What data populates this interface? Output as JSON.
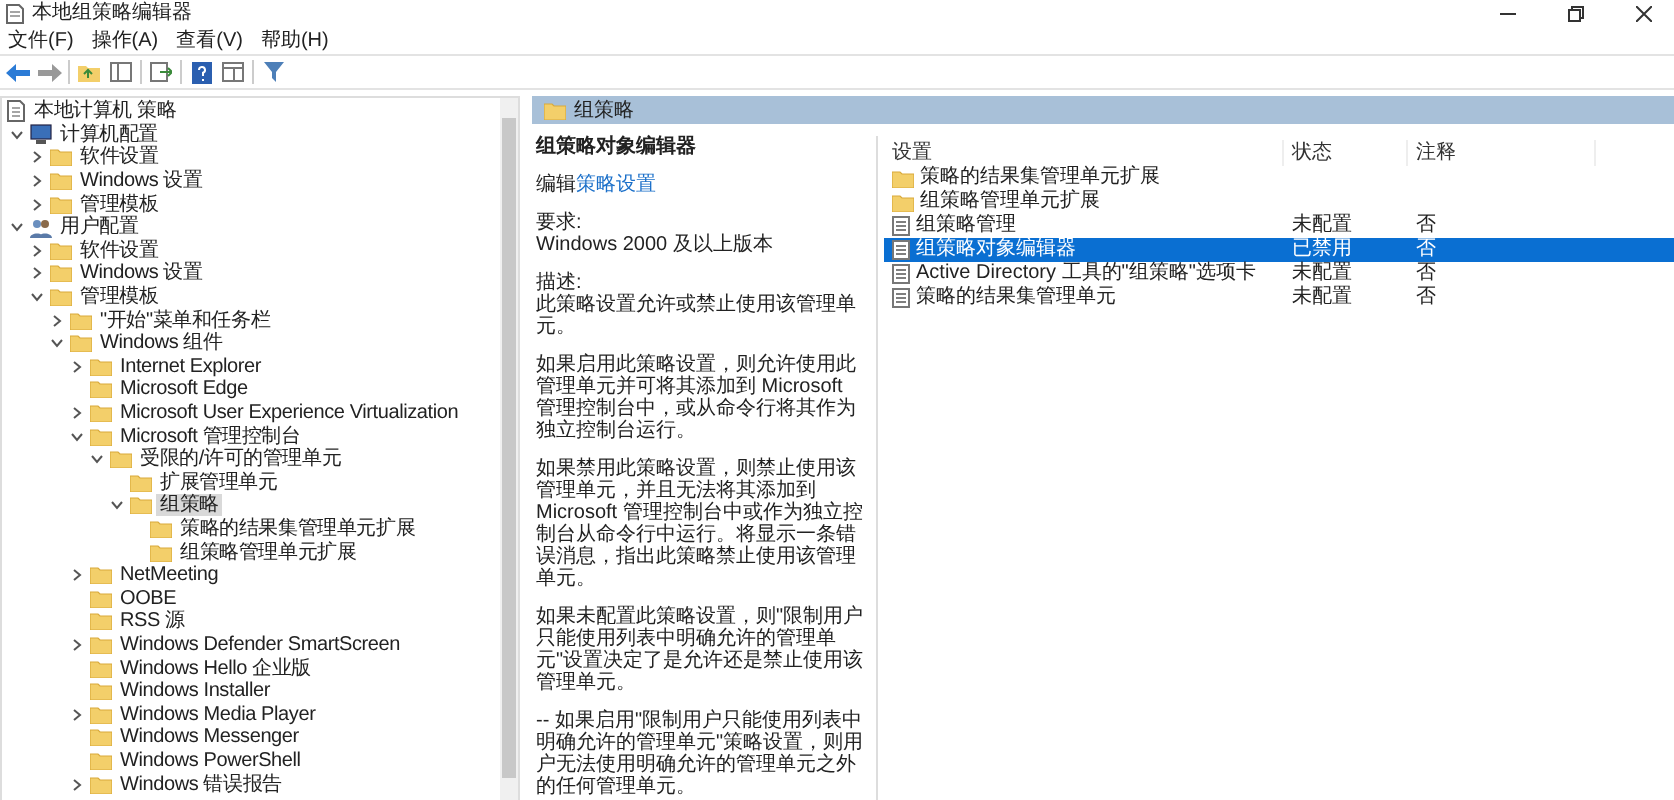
{
  "window": {
    "title": "本地组策略编辑器"
  },
  "menu": [
    "文件(F)",
    "操作(A)",
    "查看(V)",
    "帮助(H)"
  ],
  "tree": [
    {
      "label": "本地计算机 策略",
      "kind": "policy-root",
      "selected": false,
      "children": [
        {
          "label": "计算机配置",
          "kind": "computer",
          "expanded": true,
          "selected": false,
          "children": [
            {
              "label": "软件设置",
              "kind": "folder",
              "expanded": false,
              "selected": false
            },
            {
              "label": "Windows 设置",
              "kind": "folder",
              "expanded": false,
              "selected": false
            },
            {
              "label": "管理模板",
              "kind": "folder",
              "expanded": false,
              "selected": false
            }
          ]
        },
        {
          "label": "用户配置",
          "kind": "users",
          "expanded": true,
          "selected": false,
          "children": [
            {
              "label": "软件设置",
              "kind": "folder",
              "expanded": false,
              "selected": false
            },
            {
              "label": "Windows 设置",
              "kind": "folder",
              "expanded": false,
              "selected": false
            },
            {
              "label": "管理模板",
              "kind": "folder",
              "expanded": true,
              "selected": false,
              "children": [
                {
                  "label": "\"开始\"菜单和任务栏",
                  "kind": "folder",
                  "expanded": false,
                  "selected": false
                },
                {
                  "label": "Windows 组件",
                  "kind": "folder",
                  "expanded": true,
                  "selected": false,
                  "children": [
                    {
                      "label": "Internet Explorer",
                      "kind": "folder",
                      "expanded": false,
                      "selected": false
                    },
                    {
                      "label": "Microsoft Edge",
                      "kind": "folder",
                      "selected": false
                    },
                    {
                      "label": "Microsoft User Experience Virtualization",
                      "kind": "folder",
                      "expanded": false,
                      "selected": false
                    },
                    {
                      "label": "Microsoft 管理控制台",
                      "kind": "folder",
                      "expanded": true,
                      "selected": false,
                      "children": [
                        {
                          "label": "受限的/许可的管理单元",
                          "kind": "folder",
                          "expanded": true,
                          "selected": false,
                          "children": [
                            {
                              "label": "扩展管理单元",
                              "kind": "folder",
                              "selected": false
                            },
                            {
                              "label": "组策略",
                              "kind": "folder",
                              "expanded": true,
                              "selected": true,
                              "children": [
                                {
                                  "label": "策略的结果集管理单元扩展",
                                  "kind": "folder",
                                  "selected": false
                                },
                                {
                                  "label": "组策略管理单元扩展",
                                  "kind": "folder",
                                  "selected": false
                                }
                              ]
                            }
                          ]
                        }
                      ]
                    },
                    {
                      "label": "NetMeeting",
                      "kind": "folder",
                      "expanded": false,
                      "selected": false
                    },
                    {
                      "label": "OOBE",
                      "kind": "folder",
                      "selected": false
                    },
                    {
                      "label": "RSS 源",
                      "kind": "folder",
                      "selected": false
                    },
                    {
                      "label": "Windows Defender SmartScreen",
                      "kind": "folder",
                      "expanded": false,
                      "selected": false
                    },
                    {
                      "label": "Windows Hello 企业版",
                      "kind": "folder",
                      "selected": false
                    },
                    {
                      "label": "Windows Installer",
                      "kind": "folder",
                      "selected": false
                    },
                    {
                      "label": "Windows Media Player",
                      "kind": "folder",
                      "expanded": false,
                      "selected": false
                    },
                    {
                      "label": "Windows Messenger",
                      "kind": "folder",
                      "selected": false
                    },
                    {
                      "label": "Windows PowerShell",
                      "kind": "folder",
                      "selected": false
                    },
                    {
                      "label": "Windows 错误报告",
                      "kind": "folder",
                      "expanded": false,
                      "selected": false
                    }
                  ]
                }
              ]
            }
          ]
        }
      ]
    }
  ],
  "header": {
    "title": "组策略"
  },
  "description": {
    "title": "组策略对象编辑器",
    "edit_prefix": "编辑",
    "edit_link": "策略设置",
    "requirement_label": "要求:",
    "requirement": "Windows 2000 及以上版本",
    "description_label": "描述:",
    "paragraphs": [
      "此策略设置允许或禁止使用该管理单元。",
      "如果启用此策略设置，则允许使用此管理单元并可将其添加到 Microsoft 管理控制台中，或从命令行将其作为独立控制台运行。",
      "如果禁用此策略设置，则禁止使用该管理单元，并且无法将其添加到 Microsoft 管理控制台中或作为独立控制台从命令行中运行。将显示一条错误消息，指出此策略禁止使用该管理单元。",
      "如果未配置此策略设置，则\"限制用户只能使用列表中明确允许的管理单元\"设置决定了是允许还是禁止使用该管理单元。",
      "-- 如果启用\"限制用户只能使用列表中明确允许的管理单元\"策略设置，则用户无法使用明确允许的管理单元之外的任何管理单元。"
    ]
  },
  "table": {
    "columns": [
      "设置",
      "状态",
      "注释"
    ],
    "rows": [
      {
        "kind": "folder",
        "setting": "策略的结果集管理单元扩展",
        "selected": false
      },
      {
        "kind": "folder",
        "setting": "组策略管理单元扩展",
        "selected": false
      },
      {
        "kind": "setting",
        "setting": "组策略管理",
        "state": "未配置",
        "comment": "否",
        "selected": false
      },
      {
        "kind": "setting",
        "setting": "组策略对象编辑器",
        "state": "已禁用",
        "comment": "否",
        "selected": true
      },
      {
        "kind": "setting",
        "setting": "Active Directory 工具的\"组策略\"选项卡",
        "state": "未配置",
        "comment": "否",
        "selected": false
      },
      {
        "kind": "setting",
        "setting": "策略的结果集管理单元",
        "state": "未配置",
        "comment": "否",
        "selected": false
      }
    ]
  }
}
